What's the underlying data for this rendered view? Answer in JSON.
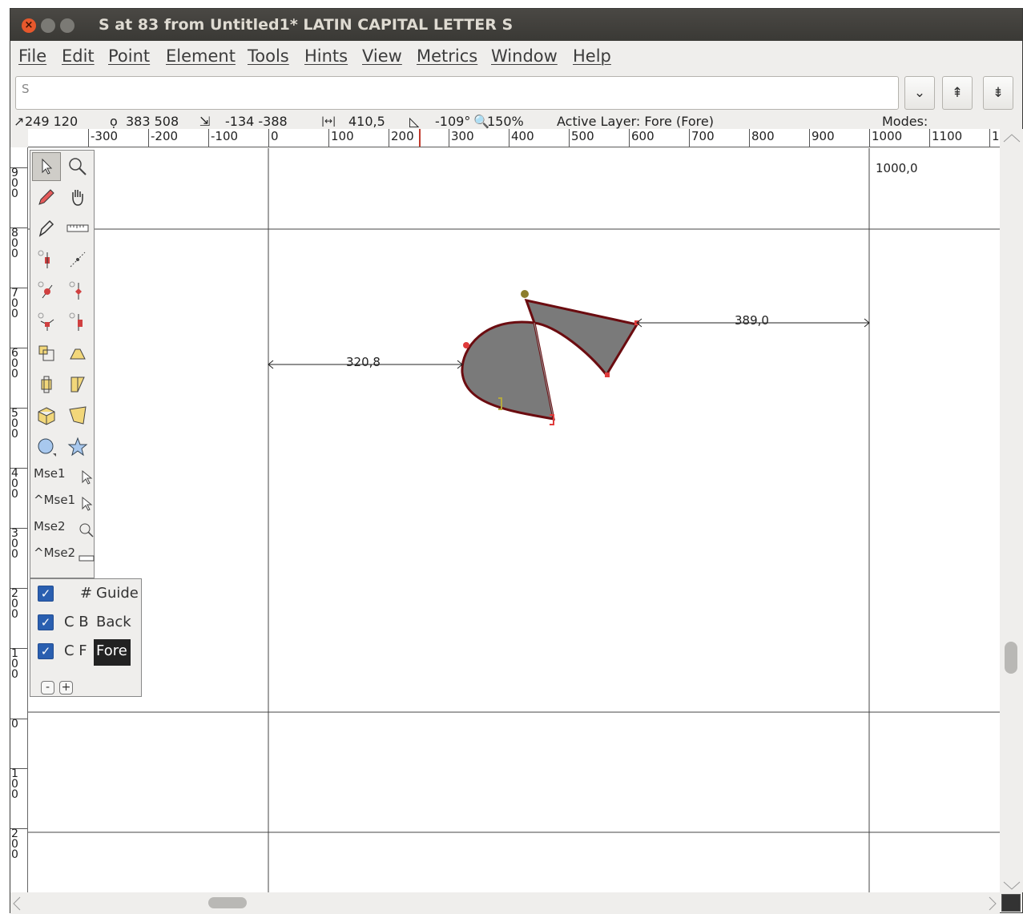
{
  "window": {
    "title": "S at 83 from Untitled1* LATIN CAPITAL LETTER S",
    "close_glyph": "×"
  },
  "menu": [
    "File",
    "Edit",
    "Point",
    "Element",
    "Tools",
    "Hints",
    "View",
    "Metrics",
    "Window",
    "Help"
  ],
  "glyph_field": {
    "value": "S"
  },
  "toolbar": {
    "dropdown_glyph": "⌄",
    "up_glyph": "⇞",
    "down_glyph": "⇟"
  },
  "info": {
    "cursor": "249 120",
    "point": "383 508",
    "delta": "-134 -388",
    "distance": "410,5",
    "angle": "-109°",
    "zoom": "150%",
    "layer": "Active Layer: Fore (Fore)",
    "modes": "Modes:"
  },
  "hruler": [
    "-300",
    "-200",
    "-100",
    "0",
    "100",
    "200",
    "300",
    "400",
    "500",
    "600",
    "700",
    "800",
    "900",
    "1000",
    "1100",
    "1"
  ],
  "vruler": [
    "9\n0\n0",
    "8\n0\n0",
    "7\n0\n0",
    "6\n0\n0",
    "5\n0\n0",
    "4\n0\n0",
    "3\n0\n0",
    "2\n0\n0",
    "1\n0\n0",
    "0",
    "1\n0\n0",
    "2\n0\n0"
  ],
  "canvas": {
    "advance_label": "1000,0",
    "left_measure": "320,8",
    "right_measure": "389,0",
    "fill_color": "#7a7a7a",
    "stroke_color": "#6b0c10"
  },
  "toolbox": {
    "mse": [
      "Mse1",
      "^Mse1",
      "Mse2",
      "^Mse2"
    ]
  },
  "layers": {
    "rows": [
      {
        "code": "#",
        "name": "Guide"
      },
      {
        "code": "C B",
        "name": "Back"
      },
      {
        "code": "C F",
        "name": "Fore"
      }
    ],
    "minus": "-",
    "plus": "+"
  },
  "colors": {
    "selection_checkbox": "#2a5fb0",
    "title_bg": "#3a3935"
  }
}
